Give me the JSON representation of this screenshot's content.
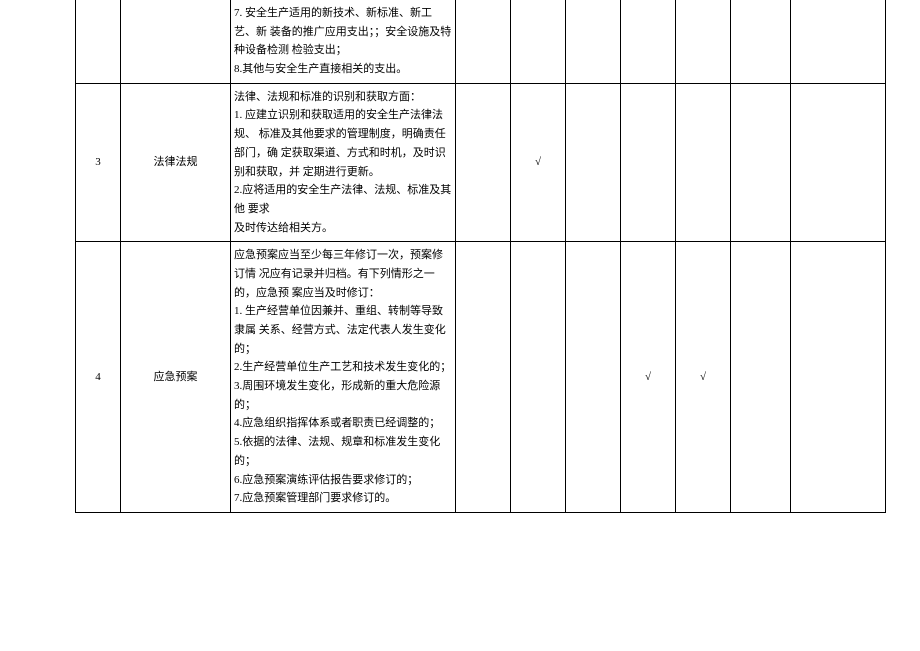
{
  "rows": [
    {
      "num": "",
      "name": "",
      "content": "7. 安全生产适用的新技术、新标准、新工艺、新 装备的推广应用支出；；安全设施及特种设备检测 检验支出；\n8.其他与安全生产直接相关的支出。",
      "checks": [
        "",
        "",
        "",
        "",
        "",
        ""
      ],
      "remark": ""
    },
    {
      "num": "3",
      "name": "法律法规",
      "content": "法律、法规和标准的识别和获取方面：\n1. 应建立识别和获取适用的安全生产法律法规、 标准及其他要求的管理制度，明确责任部门，确 定获取渠道、方式和时机，及时识别和获取，并 定期进行更新。\n2.应将适用的安全生产法律、法规、标准及其他 要求\n及时传达给相关方。",
      "checks": [
        "",
        "√",
        "",
        "",
        "",
        ""
      ],
      "remark": ""
    },
    {
      "num": "4",
      "name": "应急预案",
      "content": "应急预案应当至少每三年修订一次，预案修订情 况应有记录并归档。有下列情形之一的，应急预 案应当及时修订：\n1. 生产经营单位因兼并、重组、转制等导致隶属 关系、经营方式、法定代表人发生变化的；\n2.生产经营单位生产工艺和技术发生变化的；\n3.周围环境发生变化，形成新的重大危险源的；\n4.应急组织指挥体系或者职责已经调整的；\n5.依据的法律、法规、规章和标准发生变化的；\n6.应急预案演练评估报告要求修订的；\n7.应急预案管理部门要求修订的。",
      "checks": [
        "",
        "",
        "",
        "√",
        "√",
        ""
      ],
      "remark": ""
    }
  ]
}
